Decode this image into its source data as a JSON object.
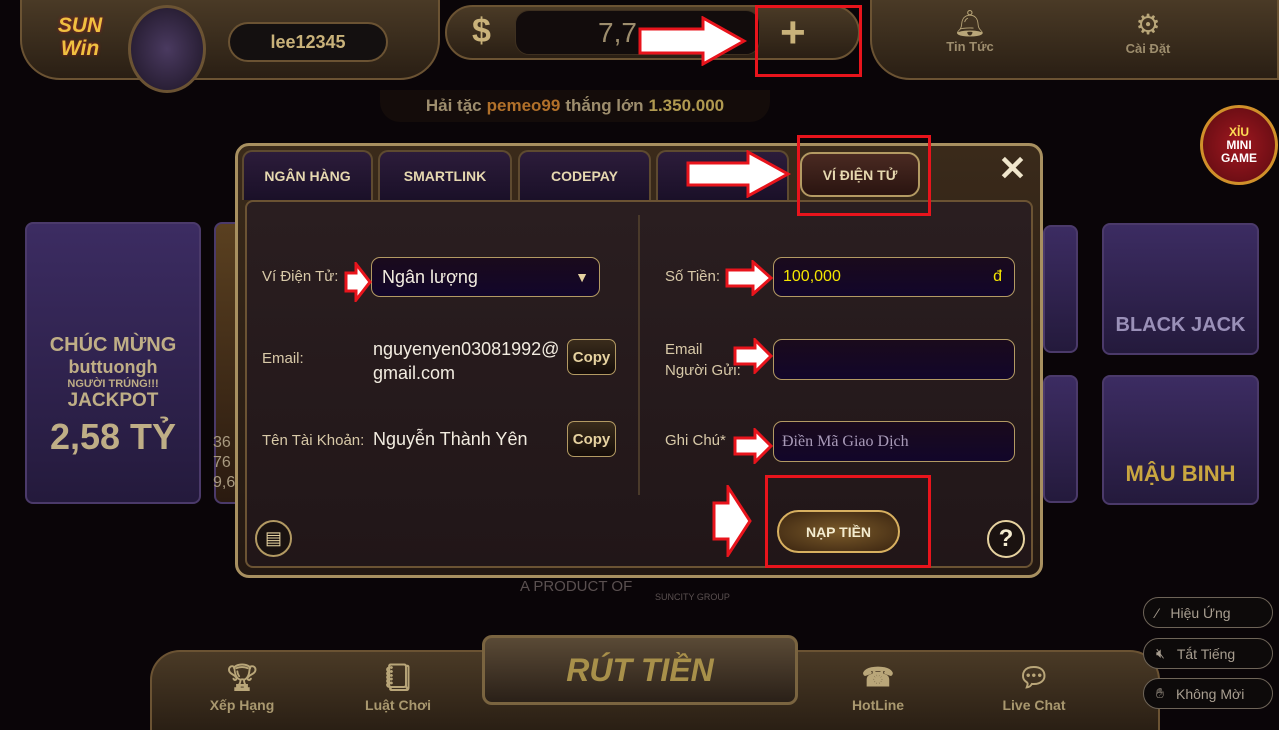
{
  "header": {
    "logo": "SUN Win",
    "username": "lee12345",
    "currency_icon": "dollar-icon",
    "balance": "7,7",
    "add_icon": "plus-icon",
    "news_label": "Tin Tức",
    "settings_label": "Cài Đặt"
  },
  "marquee": {
    "prefix": "Hải tặc",
    "player": "pemeo99",
    "middle": "thắng lớn",
    "amount": "1.350.000"
  },
  "mini_game": {
    "line1": "XỈU",
    "line2": "MINI",
    "line3": "GAME"
  },
  "background_games": {
    "jackpot_card": {
      "line1": "CHÚC MỪNG",
      "line2": "buttuongh",
      "line3": "NGƯỜI TRÚNG!!!",
      "line4": "JACKPOT",
      "amount": "2,58 TỶ"
    },
    "right_cards": [
      "BLACK JACK",
      "MẬU BINH"
    ],
    "partial_numbers": [
      "36",
      "76",
      "9,6"
    ]
  },
  "modal": {
    "tabs": [
      {
        "label": "NGÂN HÀNG",
        "active": false
      },
      {
        "label": "SMARTLINK",
        "active": false
      },
      {
        "label": "CODEPAY",
        "active": false
      },
      {
        "label": "",
        "active": false
      },
      {
        "label": "VÍ ĐIỆN TỬ",
        "active": true
      }
    ],
    "close_icon": "close-icon",
    "left": {
      "wallet_label": "Ví Điện Tử:",
      "wallet_value": "Ngân lượng",
      "email_label": "Email:",
      "email_line1": "nguyenyen03081992@",
      "email_line2": "gmail.com",
      "account_label": "Tên Tài Khoản:",
      "account_value": "Nguyễn Thành Yên",
      "copy_label": "Copy"
    },
    "right": {
      "amount_label": "Số Tiền:",
      "amount_value": "100,000",
      "currency": "đ",
      "sender_label_1": "Email",
      "sender_label_2": "Người Gửi:",
      "sender_value": "",
      "note_label": "Ghi Chú*",
      "note_placeholder": "Điền Mã Giao Dịch",
      "submit_label": "NẠP TIỀN"
    },
    "history_icon": "document-icon",
    "help_icon": "question-icon"
  },
  "footer": {
    "product_of": "A PRODUCT OF",
    "group": "SUNCITY GROUP",
    "withdraw_label": "RÚT TIỀN",
    "nav": [
      {
        "label": "Xếp Hạng",
        "icon": "trophy-icon"
      },
      {
        "label": "Luật Chơi",
        "icon": "rules-book-icon"
      },
      {
        "label": "HotLine",
        "icon": "phone-icon"
      },
      {
        "label": "Live Chat",
        "icon": "chat-icon"
      }
    ],
    "side_buttons": [
      {
        "label": "Hiệu Ứng",
        "icon": "magic-wand-icon"
      },
      {
        "label": "Tắt Tiếng",
        "icon": "mute-icon"
      },
      {
        "label": "Không Mời",
        "icon": "hand-icon"
      }
    ]
  },
  "colors": {
    "annotation_red": "#e8141c",
    "accent_gold": "#c9b27a",
    "amount_yellow": "#f5e600"
  }
}
